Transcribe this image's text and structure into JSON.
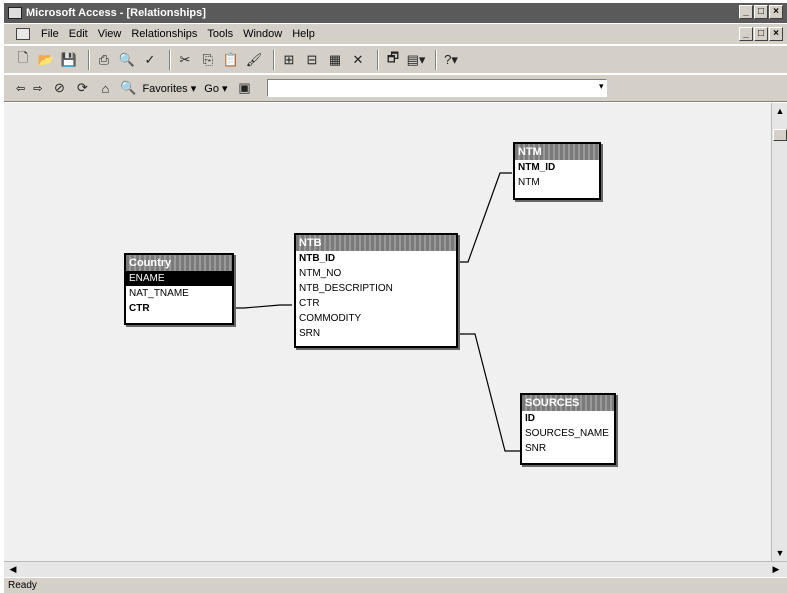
{
  "window": {
    "title": "Microsoft Access - [Relationships]"
  },
  "menu": {
    "items": [
      "File",
      "Edit",
      "View",
      "Relationships",
      "Tools",
      "Window",
      "Help"
    ]
  },
  "navbar": {
    "back": "⇦",
    "forward": "⇨",
    "favorites": "Favorites ▾",
    "go": "Go ▾"
  },
  "status": {
    "text": "Ready"
  },
  "tables": {
    "ntm": {
      "title": "NTM",
      "fields": [
        "NTM_ID",
        "NTM"
      ]
    },
    "country": {
      "title": "Country",
      "fields": [
        "ENAME",
        "NAT_TNAME",
        "CTR"
      ]
    },
    "ntb": {
      "title": "NTB",
      "fields": [
        "NTB_ID",
        "NTM_NO",
        "NTB_DESCRIPTION",
        "CTR",
        "COMMODITY",
        "SRN"
      ]
    },
    "sources": {
      "title": "SOURCES",
      "fields": [
        "ID",
        "SOURCES_NAME",
        "SNR"
      ]
    }
  }
}
